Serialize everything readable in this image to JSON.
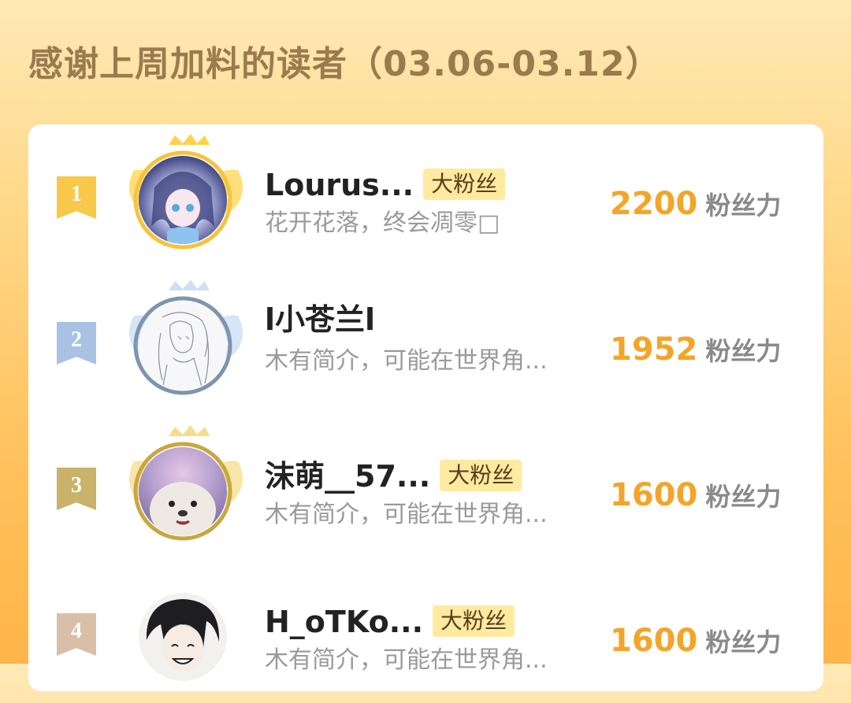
{
  "title": "感谢上周加料的读者（03.06-03.12）",
  "colors": {
    "score": "#f3a52a",
    "badge_bg": "#ffeaa0",
    "rank1": "#f7c84a",
    "rank2": "#a9c2e4",
    "rank3": "#c9b36a",
    "rank4": "#d9bfa8"
  },
  "badge_label": "大粉丝",
  "score_unit": "粉丝力",
  "readers": [
    {
      "rank": "1",
      "name": "Lourus...",
      "bio": "花开花落，终会凋零□",
      "score": "2200",
      "has_badge": true
    },
    {
      "rank": "2",
      "name": "l小苍兰l",
      "bio": "木有简介，可能在世界角...",
      "score": "1952",
      "has_badge": false
    },
    {
      "rank": "3",
      "name": "沫萌__57...",
      "bio": "木有简介，可能在世界角...",
      "score": "1600",
      "has_badge": true
    },
    {
      "rank": "4",
      "name": "H_oTKo...",
      "bio": "木有简介，可能在世界角...",
      "score": "1600",
      "has_badge": true
    }
  ]
}
